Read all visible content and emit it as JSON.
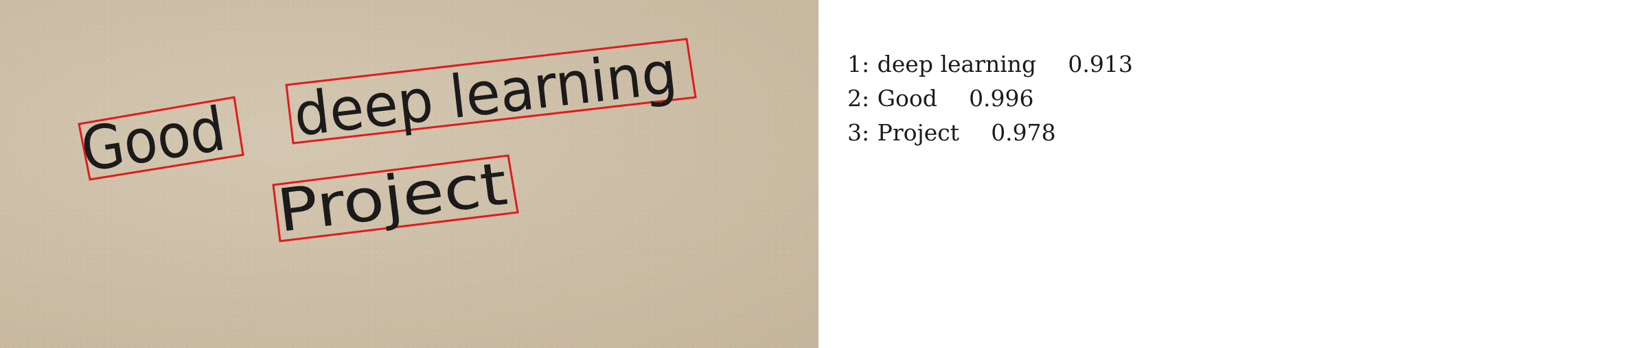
{
  "photo": {
    "words": [
      {
        "id": 1,
        "text": "deep learning"
      },
      {
        "id": 2,
        "text": "Good"
      },
      {
        "id": 3,
        "text": "Project"
      }
    ],
    "box_color": "#e01b1b",
    "ink_color": "#1a1a1a"
  },
  "results": [
    {
      "index": "1:",
      "text": "deep learning",
      "score": "0.913"
    },
    {
      "index": "2:",
      "text": "Good",
      "score": "0.996"
    },
    {
      "index": "3:",
      "text": "Project",
      "score": "0.978"
    }
  ]
}
